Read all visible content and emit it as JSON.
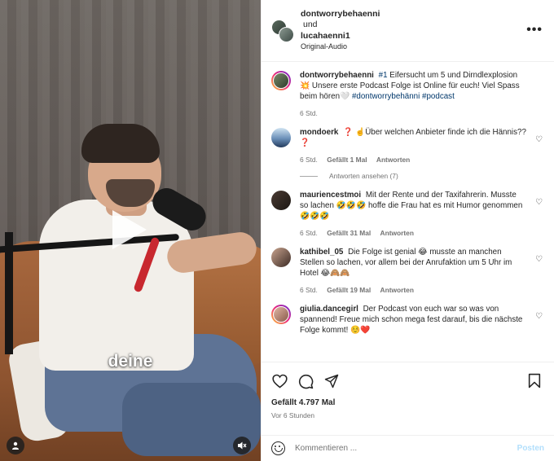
{
  "video": {
    "caption": "deine",
    "icons": {
      "play": "play-icon",
      "user": "user-tag-icon",
      "mute": "speaker-muted-icon"
    }
  },
  "header": {
    "user1": "dontworrybehaenni",
    "joiner": "und",
    "user2": "lucahaenni1",
    "audio": "Original-Audio",
    "more": "•••"
  },
  "post": {
    "username": "dontworrybehaenni",
    "tag1": "#1",
    "caption_a": "Eifersucht um 5 und Dirndlexplosion 💥 Unsere erste Podcast Folge ist Online für euch! Viel Spass beim hören🤍",
    "tag2": "#dontworrybehänni",
    "tag3": "#podcast",
    "time": "6 Std."
  },
  "comments": [
    {
      "username": "mondoerk",
      "text": "❓ ☝️Über welchen Anbieter finde ich die Hännis?? ❓",
      "time": "6 Std.",
      "likes": "Gefällt 1 Mal",
      "reply": "Antworten",
      "replies": "Antworten ansehen (7)"
    },
    {
      "username": "mauriencestmoi",
      "text": "Mit der Rente und der Taxifahrerin. Musste so lachen 🤣🤣🤣 hoffe die Frau hat es mit Humor genommen 🤣🤣🤣",
      "time": "6 Std.",
      "likes": "Gefällt 31 Mal",
      "reply": "Antworten"
    },
    {
      "username": "kathibel_05",
      "text": "Die Folge ist genial 😂 musste an manchen Stellen so lachen, vor allem bei der Anrufaktion um 5 Uhr im Hotel 😂🙈🙈",
      "time": "6 Std.",
      "likes": "Gefällt 19 Mal",
      "reply": "Antworten"
    },
    {
      "username": "giulia.dancegirl",
      "text": "Der Podcast von euch war so was von spannend! Freue mich schon mega fest darauf, bis die nächste Folge kommt! ☺️❤️"
    }
  ],
  "actions": {
    "likes": "Gefällt 4.797 Mal",
    "time": "Vor 6 Stunden"
  },
  "composer": {
    "placeholder": "Kommentieren ...",
    "post": "Posten"
  },
  "colors": {
    "link": "#00376b",
    "muted": "#737373",
    "post_disabled": "#b2dffc",
    "sofa": "#a8683e"
  }
}
